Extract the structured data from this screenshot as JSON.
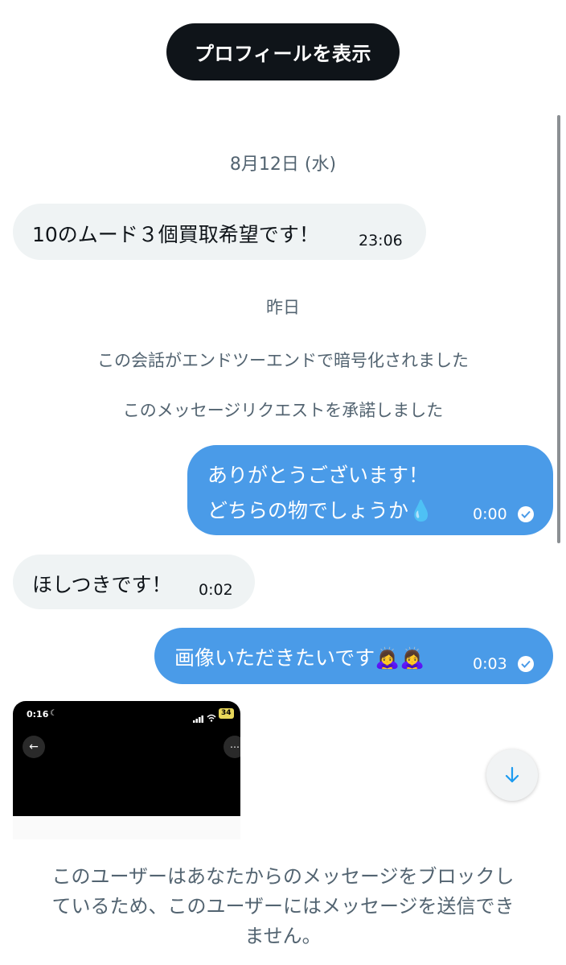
{
  "header": {
    "profile_button_label": "プロフィールを表示"
  },
  "dates": {
    "first": "8月12日 (水)",
    "second": "昨日"
  },
  "system_messages": [
    "この会話がエンドツーエンドで暗号化されました",
    "このメッセージリクエストを承諾しました"
  ],
  "messages": [
    {
      "direction": "received",
      "text": "10のムード３個買取希望です！",
      "time": "23:06"
    },
    {
      "direction": "sent",
      "lines": [
        "ありがとうございます！",
        "どちらの物でしょうか💧"
      ],
      "time": "0:00"
    },
    {
      "direction": "received",
      "text": "ほしつきです！",
      "time": "0:02"
    },
    {
      "direction": "sent",
      "text": "画像いただきたいです🙇‍♀️🙇‍♀️",
      "time": "0:03"
    }
  ],
  "image_preview": {
    "status_time": "0:16",
    "battery": "34"
  },
  "footer": {
    "blocked_notice_lines": [
      "このユーザーはあなたからのメッセージをブロックし",
      "ているため、このユーザーにはメッセージを送信でき",
      "ません。"
    ]
  },
  "colors": {
    "sent_bubble": "#4a9be8",
    "received_bubble": "#eff3f4",
    "button": "#0f1419"
  }
}
